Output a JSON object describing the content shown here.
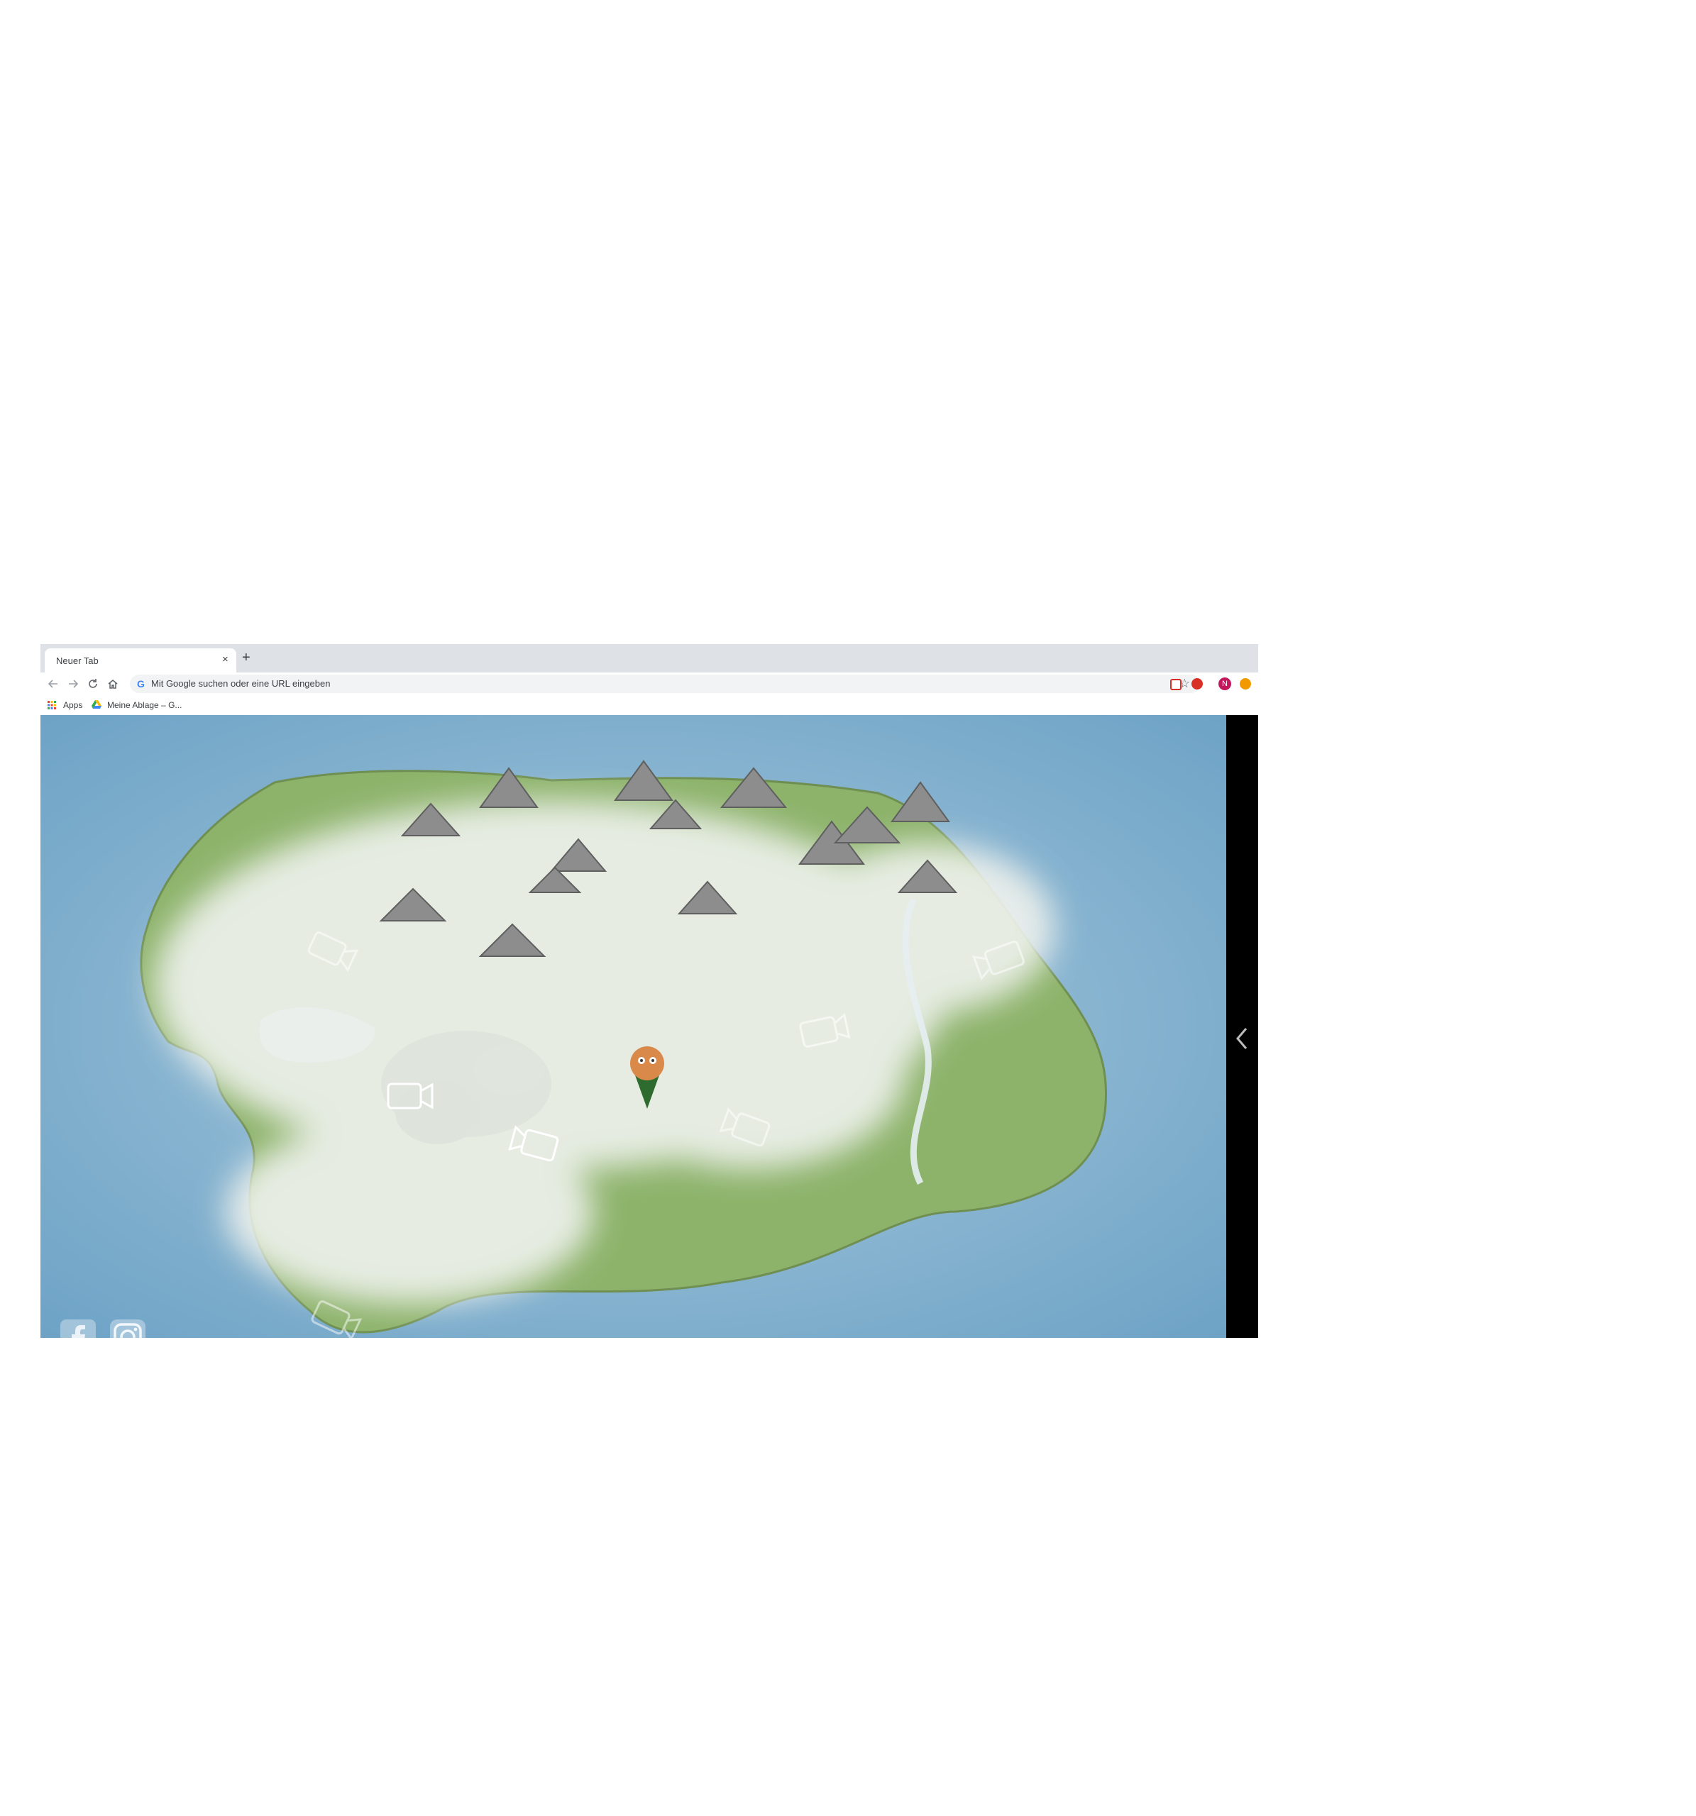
{
  "browser": {
    "tab": {
      "title": "Neuer Tab",
      "close": "×"
    },
    "new_tab": "+",
    "omnibox": {
      "google_letter": "G",
      "placeholder": "Mit Google suchen oder eine URL eingeben"
    },
    "star": "☆",
    "profile_initial": "N",
    "bookmarks": {
      "apps": "Apps",
      "drive": "Meine Ablage – G..."
    }
  },
  "colors": {
    "sea": "#7fb0d0",
    "land": "#8db36b",
    "fog": "#eef1ec",
    "forest": "#355f2f",
    "panel": "#000000"
  }
}
